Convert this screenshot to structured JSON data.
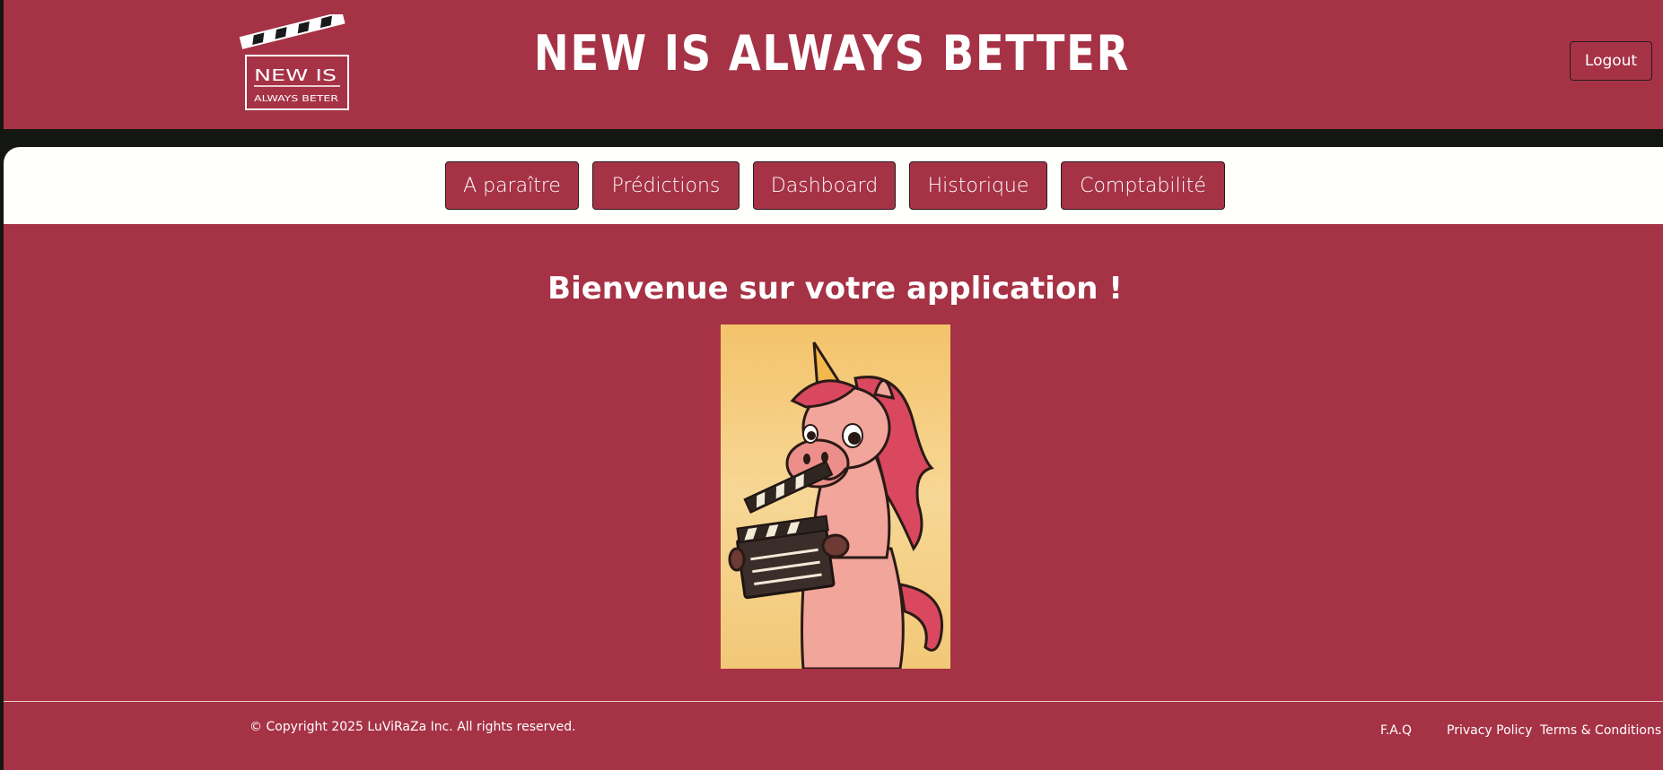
{
  "header": {
    "logo": {
      "line1": "NEW IS",
      "line2": "ALWAYS BETER"
    },
    "title": "NEW IS ALWAYS BETTER",
    "logout_label": "Logout"
  },
  "nav": {
    "items": [
      {
        "label": "A paraître"
      },
      {
        "label": "Prédictions"
      },
      {
        "label": "Dashboard"
      },
      {
        "label": "Historique"
      },
      {
        "label": "Comptabilité"
      }
    ]
  },
  "main": {
    "welcome": "Bienvenue sur votre application !",
    "image": "unicorn-clapperboard-illustration"
  },
  "footer": {
    "copyright": "© Copyright 2025 LuViRaZa Inc. All rights reserved.",
    "links": [
      {
        "label": "F.A.Q"
      },
      {
        "label": "Privacy Policy"
      },
      {
        "label": "Terms & Conditions"
      }
    ]
  },
  "colors": {
    "brand": "#a63246",
    "dark": "#141612",
    "nav_bg": "#fffffc",
    "text_light": "#ffffff"
  }
}
